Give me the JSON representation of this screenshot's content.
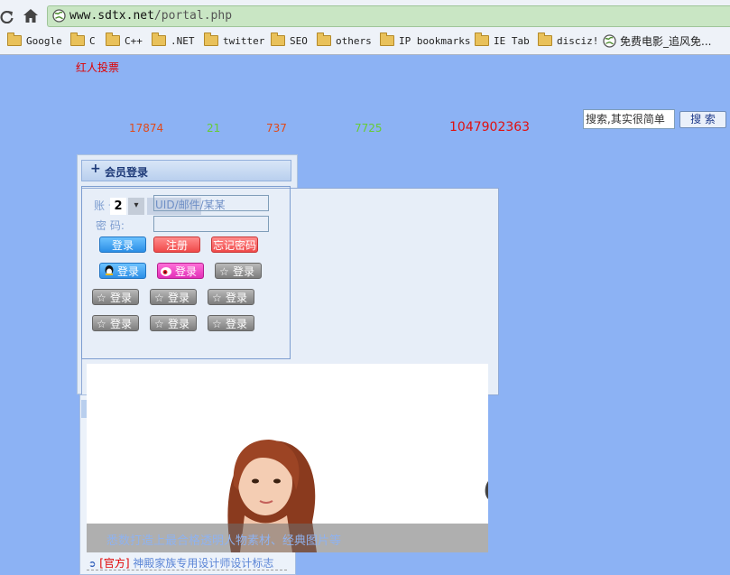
{
  "browser": {
    "url_host": "www.sdtx.net",
    "url_path": "/portal.php",
    "bookmarks": [
      "Google",
      "C",
      "C++",
      ".NET",
      "twitter",
      "SEO",
      "others",
      "IP bookmarks",
      "IE Tab",
      "disciz!",
      "免费电影_追风免..."
    ]
  },
  "page": {
    "red_link": "红人投票",
    "stats": [
      "17874",
      "21",
      "737",
      "7725",
      "1047902363"
    ],
    "search_placeholder": "搜索,其实很简单",
    "search_button": "搜 索",
    "login": {
      "header_icon": "+",
      "title": "会员登录",
      "username_label": "账 号:",
      "username_overlay_num": "2",
      "username_hint": "UID/邮件/某某",
      "password_label": "密 码:",
      "login_btn": "登录",
      "register_btn": "注册",
      "forgot_btn": "忘记密码",
      "social_login": "登录"
    },
    "slide_caption": "悉数打造上最合格透明人物素材、经典图片等",
    "news_tag": "[官方]",
    "news_text": "神殿家族专用设计师设计标志"
  },
  "colors": {
    "page_bg": "#8cb2f4",
    "omnibox_bg": "#c9e6c4",
    "red": "#e00000",
    "green_stat": "#66cc33",
    "link_blue": "#5b85d6"
  }
}
